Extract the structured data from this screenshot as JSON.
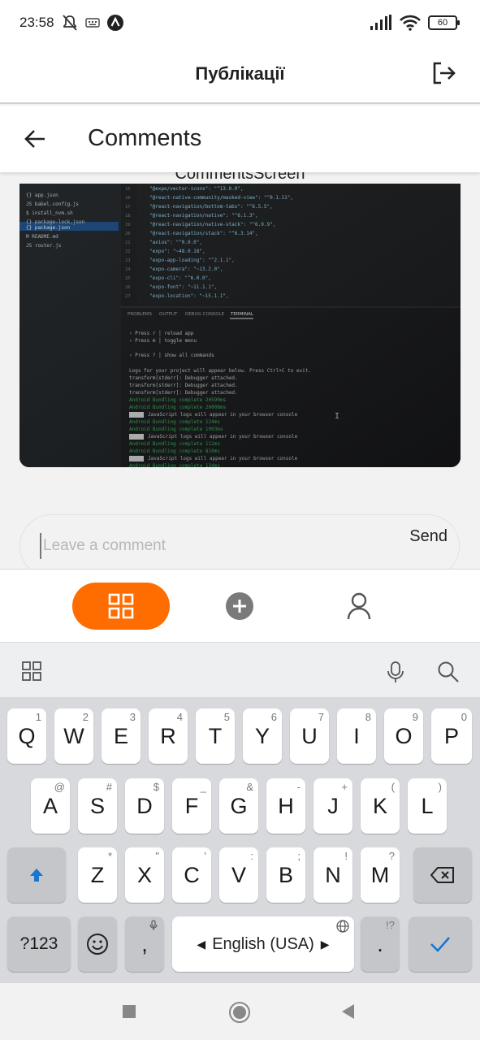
{
  "status_bar": {
    "time": "23:58",
    "battery": "60",
    "icons": [
      "mute-icon",
      "keyboard-icon",
      "app-a-icon",
      "signal-icon",
      "wifi-icon",
      "battery-icon"
    ]
  },
  "header": {
    "title": "Публікації",
    "logout_icon": "logout-icon"
  },
  "comments_header": {
    "title": "Comments",
    "back_icon": "arrow-left-icon"
  },
  "screen_name": "CommentsScreen",
  "photo": {
    "editor_files": [
      "app.json",
      "babel.config.js",
      "install_nvm.sh",
      "package-lock.json",
      "package.json",
      "README.md",
      "router.js"
    ],
    "terminal_tabs": [
      "PROBLEMS",
      "OUTPUT",
      "DEBUG CONSOLE",
      "TERMINAL"
    ]
  },
  "comment_input": {
    "placeholder": "Leave a comment",
    "value": ""
  },
  "send_label": "Send",
  "tabs": {
    "items": [
      "grid-icon",
      "plus-circle-icon",
      "user-icon"
    ],
    "active": 0,
    "active_color": "#ff6c00"
  },
  "keyboard": {
    "row1": [
      {
        "key": "Q",
        "hint": "1"
      },
      {
        "key": "W",
        "hint": "2"
      },
      {
        "key": "E",
        "hint": "3"
      },
      {
        "key": "R",
        "hint": "4"
      },
      {
        "key": "T",
        "hint": "5"
      },
      {
        "key": "Y",
        "hint": "6"
      },
      {
        "key": "U",
        "hint": "7"
      },
      {
        "key": "I",
        "hint": "8"
      },
      {
        "key": "O",
        "hint": "9"
      },
      {
        "key": "P",
        "hint": "0"
      }
    ],
    "row2": [
      {
        "key": "A",
        "hint": "@"
      },
      {
        "key": "S",
        "hint": "#"
      },
      {
        "key": "D",
        "hint": "$"
      },
      {
        "key": "F",
        "hint": "_"
      },
      {
        "key": "G",
        "hint": "&"
      },
      {
        "key": "H",
        "hint": "-"
      },
      {
        "key": "J",
        "hint": "+"
      },
      {
        "key": "K",
        "hint": "("
      },
      {
        "key": "L",
        "hint": ")"
      }
    ],
    "row3": [
      {
        "key": "Z",
        "hint": "*"
      },
      {
        "key": "X",
        "hint": "\""
      },
      {
        "key": "C",
        "hint": "'"
      },
      {
        "key": "V",
        "hint": ":"
      },
      {
        "key": "B",
        "hint": ";"
      },
      {
        "key": "N",
        "hint": "!"
      },
      {
        "key": "M",
        "hint": "?"
      }
    ],
    "symbols_label": "?123",
    "comma_label": ",",
    "space_label": "English (USA)",
    "period_label": ".",
    "period_hint": "!?"
  }
}
